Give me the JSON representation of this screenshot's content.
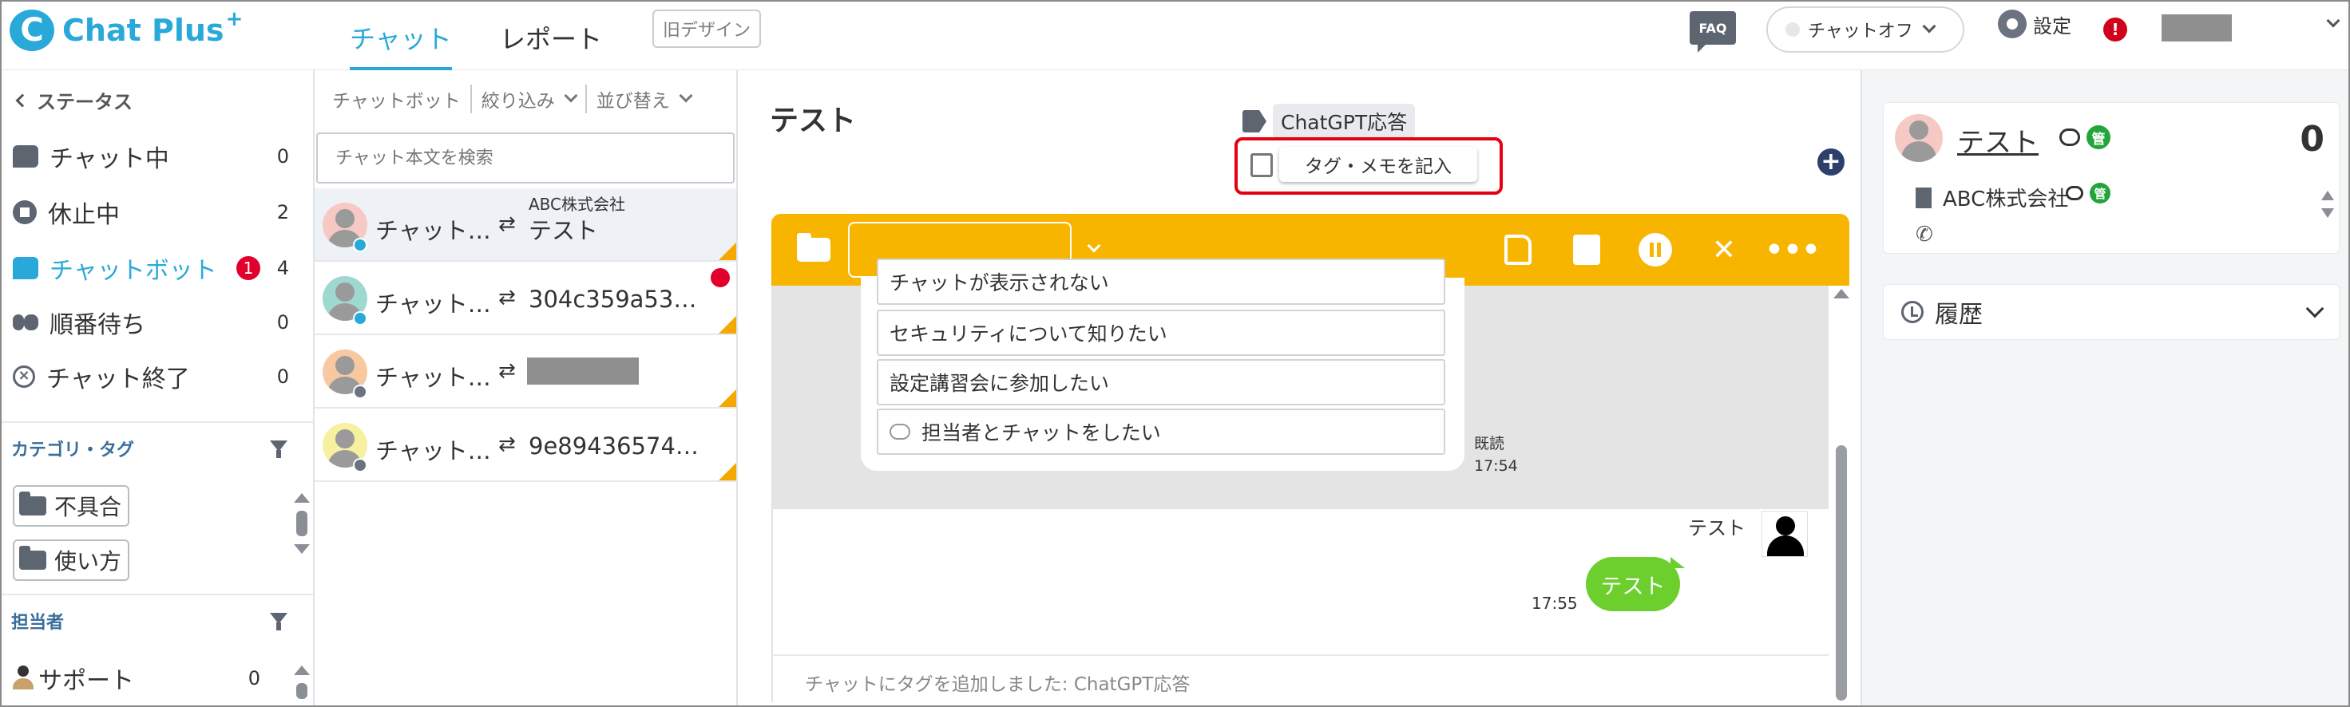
{
  "header": {
    "logo_text": "Chat Plus",
    "logo_plus": "+",
    "tabs": [
      {
        "label": "チャット",
        "active": true
      },
      {
        "label": "レポート",
        "active": false
      }
    ],
    "old_design_label": "旧デザイン",
    "faq_label": "FAQ",
    "chat_status_label": "チャットオフ",
    "settings_label": "設定",
    "alert_label": "!"
  },
  "sidebar": {
    "back_label": "ステータス",
    "status_items": [
      {
        "label": "チャット中",
        "count": "0",
        "icon": "chat-icon"
      },
      {
        "label": "休止中",
        "count": "2",
        "icon": "pause-icon"
      },
      {
        "label": "チャットボット",
        "count": "4",
        "badge": "1",
        "icon": "bot-chat-icon",
        "active": true
      },
      {
        "label": "順番待ち",
        "count": "0",
        "icon": "queue-icon"
      },
      {
        "label": "チャット終了",
        "count": "0",
        "icon": "end-icon"
      }
    ],
    "category_section_label": "カテゴリ・タグ",
    "categories": [
      {
        "label": "不具合"
      },
      {
        "label": "使い方"
      }
    ],
    "operator_section_label": "担当者",
    "operators": [
      {
        "label": "サポート",
        "count": "0"
      }
    ]
  },
  "chatlist": {
    "toolbar": {
      "chatbot_label": "チャットボット",
      "filter_label": "絞り込み",
      "sort_label": "並び替え"
    },
    "search_placeholder": "チャット本文を検索",
    "rows": [
      {
        "name": "チャット…",
        "company": "ABC株式会社",
        "title": "テスト",
        "avatar_color": "#f6c9c4",
        "status_color": "#29a9d9",
        "selected": true,
        "corner": true,
        "unread": false
      },
      {
        "name": "チャット…",
        "company": "",
        "title": "304c359a53…",
        "avatar_color": "#9ed8cf",
        "status_color": "#29a9d9",
        "selected": false,
        "corner": true,
        "unread": true
      },
      {
        "name": "チャット…",
        "company": "",
        "title": "",
        "avatar_color": "#f8c8a0",
        "status_color": "#6b7380",
        "selected": false,
        "corner": true,
        "unread": false
      },
      {
        "name": "チャット…",
        "company": "",
        "title": "9e89436574…",
        "avatar_color": "#f6f0a0",
        "status_color": "#6b7380",
        "selected": false,
        "corner": true,
        "unread": false
      }
    ]
  },
  "chatmain": {
    "title": "テスト",
    "tag_label": "ChatGPT応答",
    "memo_button_label": "タグ・メモを記入",
    "add_label": "+",
    "toolbar_icons": [
      "folder-icon",
      "add-note-icon",
      "document-icon",
      "pause-icon",
      "close-icon",
      "more-icon"
    ],
    "bot_options": [
      {
        "label": "チャットが表示されない"
      },
      {
        "label": "セキュリティについて知りたい"
      },
      {
        "label": "設定講習会に参加したい"
      },
      {
        "label": "担当者とチャットをしたい",
        "has_icon": true
      }
    ],
    "read_label": "既読",
    "read_time": "17:54",
    "user_message": {
      "sender": "テスト",
      "text": "テスト",
      "time": "17:55"
    },
    "system_message": "チャットにタグを追加しました: ChatGPT応答"
  },
  "rightpanel": {
    "visitor_name": "テスト",
    "badge_label": "管",
    "count": "0",
    "company": "ABC株式会社",
    "phone_symbol": "✆",
    "history_label": "履歴"
  },
  "colors": {
    "brand": "#29a9d9",
    "toolbar": "#f7b500",
    "alert": "#e1002d",
    "user_bubble": "#6ccf2e",
    "highlight": "#e60012"
  }
}
